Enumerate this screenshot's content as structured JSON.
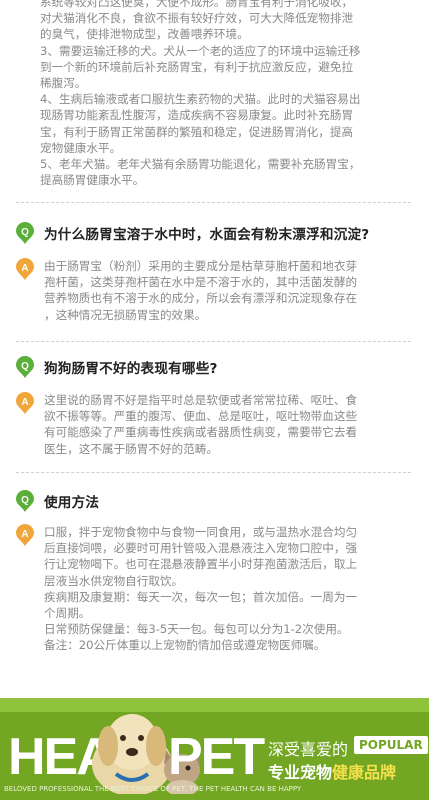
{
  "intro": {
    "lines": [
      "系统等较对凸这便臭，大便不成形。肠胃宝有利于消化吸收，",
      "对犬猫消化不良，食欲不振有较好疗效，可大大降低宠物排泄",
      "的臭气，使排泄物成型，改善喂养环境。",
      "3、需要运输迁移的犬。犬从一个老的适应了的环境中运输迁移",
      "到一个新的环境前后补充肠胃宝，有利于抗应激反应，避免拉",
      "稀腹泻。",
      "4、生病后输液或者口服抗生素药物的犬猫。此时的犬猫容易出",
      "现肠胃功能紊乱性腹泻，造成疾病不容易康复。此时补充肠胃",
      "宝，有利于肠胃正常菌群的繁殖和稳定，促进肠胃消化，提高",
      "宠物健康水平。",
      "5、老年犬猫。老年犬猫有余肠胃功能退化，需要补充肠胃宝，",
      "提高肠胃健康水平。"
    ]
  },
  "badges": {
    "q": "Q",
    "a": "A",
    "color": "#5aae3a",
    "a_color": "#f0a63a"
  },
  "qa": [
    {
      "question": "为什么肠胃宝溶于水中时，水面会有粉末漂浮和沉淀?",
      "answer_lines": [
        "由于肠胃宝（粉剂）采用的主要成分是枯草芽胞杆菌和地衣芽",
        "孢杆菌，这类芽孢杆菌在水中是不溶于水的，其中活菌发酵的",
        "营养物质也有不溶于水的成分，所以会有漂浮和沉淀现象存在",
        "，这种情况无损肠胃宝的效果。"
      ]
    },
    {
      "question": "狗狗肠胃不好的表现有哪些?",
      "answer_lines": [
        "这里说的肠胃不好是指平时总是软便或者常常拉稀、呕吐、食",
        "欲不振等等。严重的腹泻、便血、总是呕吐，呕吐物带血这些",
        "有可能感染了严重病毒性疾病或者器质性病变，需要带它去看",
        "医生，这不属于肠胃不好的范畴。"
      ]
    },
    {
      "question": "使用方法",
      "answer_lines": [
        "口服，拌于宠物食物中与食物一同食用，或与温热水混合均匀",
        "后直接饲喂，必要时可用针管吸入混悬液注入宠物口腔中，强",
        "行让宠物喝下。也可在混悬液静置半小时芽孢菌激活后，取上",
        "层液当水供宠物自行取饮。",
        "疾病期及康复期：每天一次，每次一包；首次加倍。一周为一",
        "个周期。",
        "日常预防保健量：每3-5天一包。每包可以分为1-2次使用。",
        "备注：20公斤体重以上宠物酌情加倍或遵宠物医师嘱。"
      ]
    }
  ],
  "banner": {
    "word_left": "HEA",
    "word_right": "PET",
    "tagline": "深受喜爱的",
    "popular": "POPULAR",
    "brand_prefix": "专业宠物",
    "brand_suffix": "健康品牌",
    "footer": "BELOVED PROFESSIONAL                                    THE BEST CHOICE OF PET, THE PET HEALTH CAN BE HAPPY"
  }
}
